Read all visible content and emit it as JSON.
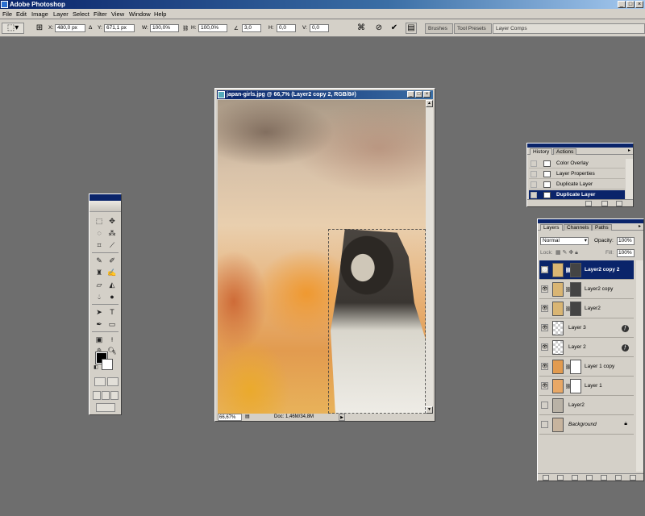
{
  "app": {
    "title": "Adobe Photoshop"
  },
  "menu": [
    "File",
    "Edit",
    "Image",
    "Layer",
    "Select",
    "Filter",
    "View",
    "Window",
    "Help"
  ],
  "options": {
    "x_label": "X:",
    "x_value": "480,0 px",
    "y_label": "Y:",
    "y_value": "671,1 px",
    "w_label": "W:",
    "w_value": "100,0%",
    "h_label": "H:",
    "h_value": "100,0%",
    "angle_value": "3,0",
    "hskew_label": "H:",
    "hskew_value": "0,0",
    "vskew_label": "V:",
    "vskew_value": "0,0",
    "delta_symbol": "Δ",
    "angle_symbol": "∠",
    "cancel_icon": "⊘",
    "commit_icon": "✔",
    "chain_icon": "⛓",
    "warp_icon": "⌘",
    "palette_well_tabs": [
      "Brushes",
      "Tool Presets",
      "Layer Comps"
    ]
  },
  "document": {
    "title": "japan-girls.jpg @ 66,7% (Layer2 copy 2, RGB/8#)",
    "zoom": "66,67%",
    "doc_size": "Doc: 1,46M/34,8M"
  },
  "history": {
    "tabs": [
      "History",
      "Actions"
    ],
    "items": [
      "Color Overlay",
      "Layer Properties",
      "Duplicate Layer",
      "Duplicate Layer"
    ]
  },
  "layers": {
    "tabs": [
      "Layers",
      "Channels",
      "Paths"
    ],
    "blend_mode": "Normal",
    "opacity_label": "Opacity:",
    "opacity_value": "100%",
    "lock_label": "Lock:",
    "fill_label": "Fill:",
    "fill_value": "100%",
    "items": [
      {
        "name": "Layer2 copy 2"
      },
      {
        "name": "Layer2 copy"
      },
      {
        "name": "Layer2"
      },
      {
        "name": "Layer 3"
      },
      {
        "name": "Layer 2"
      },
      {
        "name": "Layer 1 copy"
      },
      {
        "name": "Layer 1"
      },
      {
        "name": "Layer2"
      },
      {
        "name": "Background"
      }
    ]
  },
  "colors": {
    "titlebar": "#0a246a",
    "panel": "#d4d0c8",
    "workspace": "#6e6e6e",
    "selection": "#0a246a"
  }
}
